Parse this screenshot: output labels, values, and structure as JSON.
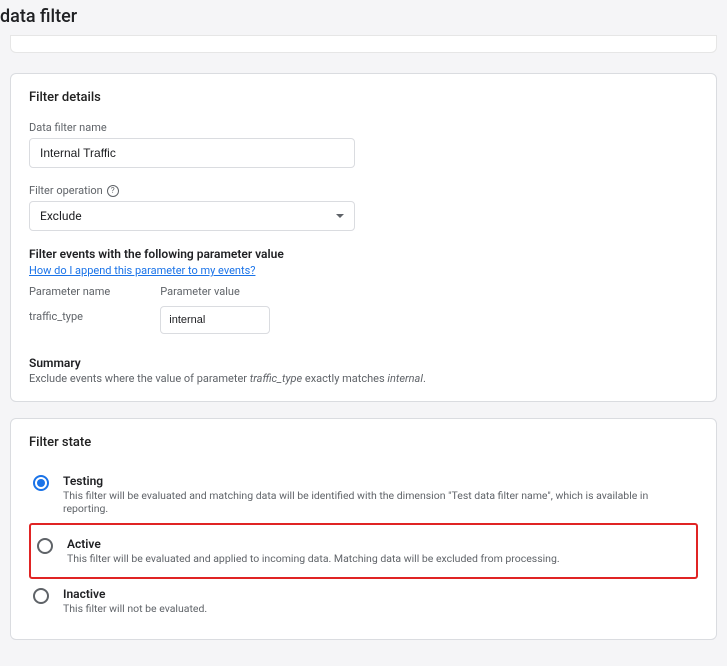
{
  "header": {
    "title": "data filter"
  },
  "details": {
    "title": "Filter details",
    "name_label": "Data filter name",
    "name_value": "Internal Traffic",
    "operation_label": "Filter operation",
    "operation_value": "Exclude",
    "events_section_title": "Filter events with the following parameter value",
    "append_link": "How do I append this parameter to my events?",
    "param_name_label": "Parameter name",
    "param_value_label": "Parameter value",
    "param_name": "traffic_type",
    "param_value": "internal",
    "summary_label": "Summary",
    "summary_prefix": "Exclude events where the value of parameter ",
    "summary_param": "traffic_type",
    "summary_mid": " exactly matches ",
    "summary_match": "internal",
    "summary_suffix": "."
  },
  "state": {
    "title": "Filter state",
    "options": [
      {
        "id": "testing",
        "label": "Testing",
        "desc": "This filter will be evaluated and matching data will be identified with the dimension \"Test data filter name\", which is available in reporting.",
        "selected": true
      },
      {
        "id": "active",
        "label": "Active",
        "desc": "This filter will be evaluated and applied to incoming data. Matching data will be excluded from processing.",
        "selected": false,
        "highlighted": true
      },
      {
        "id": "inactive",
        "label": "Inactive",
        "desc": "This filter will not be evaluated.",
        "selected": false
      }
    ]
  }
}
